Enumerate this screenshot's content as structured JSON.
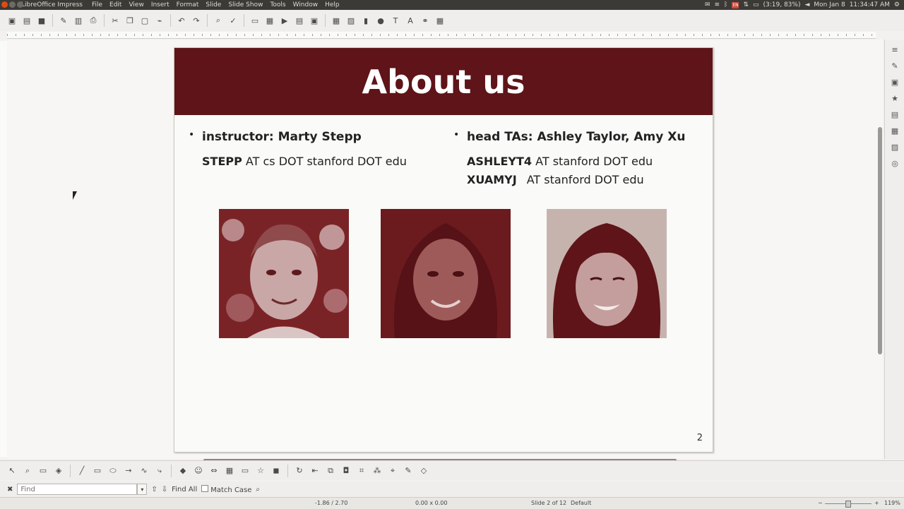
{
  "topbar": {
    "app_name": "LibreOffice Impress",
    "menus": [
      "File",
      "Edit",
      "View",
      "Insert",
      "Format",
      "Slide",
      "Slide Show",
      "Tools",
      "Window",
      "Help"
    ],
    "tray": {
      "lang": "EN",
      "battery": "(3:19, 83%)",
      "date": "Mon Jan 8",
      "time": "11:34:47 AM"
    }
  },
  "slide": {
    "title": "About us",
    "instructor_line": "instructor: Marty Stepp",
    "instructor_email_bold": "STEPP",
    "instructor_email_rest": " AT cs DOT stanford DOT edu",
    "tas_line": "head TAs: Ashley Taylor, Amy Xu",
    "ta1_bold": "ASHLEYT4",
    "ta1_rest": " AT stanford DOT edu",
    "ta2_bold": "XUAMYJ",
    "ta2_rest": "AT stanford DOT edu",
    "page_number": "2"
  },
  "findbar": {
    "placeholder": "Find",
    "find_all": "Find All",
    "match_case": "Match Case"
  },
  "statusbar": {
    "position": "-1.86 / 2.70",
    "size": "0.00 x 0.00",
    "slide_info": "Slide 2 of 12",
    "layout": "Default",
    "zoom": "119%"
  },
  "colors": {
    "title_bar": "#5e1418",
    "photo_tint": "#6a1a1e"
  }
}
